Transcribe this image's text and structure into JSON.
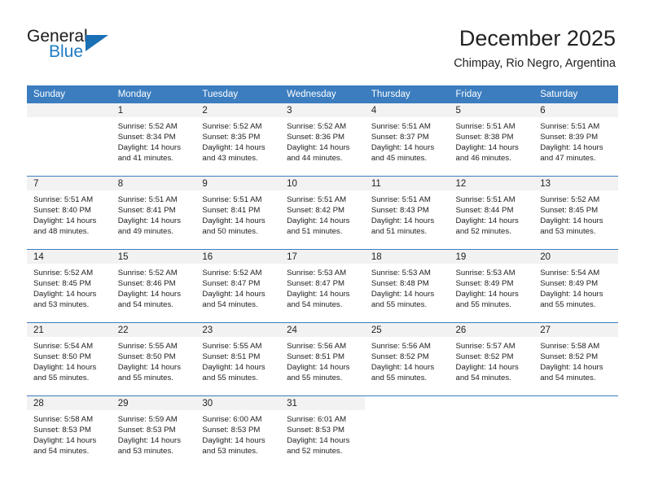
{
  "branding": {
    "logo_text_top": "General",
    "logo_text_bottom": "Blue",
    "logo_triangle_icon": "triangle-icon",
    "brand_blue": "#1d7cc4",
    "header_blue": "#3b7dbf"
  },
  "header": {
    "title": "December 2025",
    "location": "Chimpay, Rio Negro, Argentina"
  },
  "calendar": {
    "weekday_headers": [
      "Sunday",
      "Monday",
      "Tuesday",
      "Wednesday",
      "Thursday",
      "Friday",
      "Saturday"
    ],
    "weeks": [
      [
        {
          "blank": true
        },
        {
          "day": "1",
          "sunrise": "Sunrise: 5:52 AM",
          "sunset": "Sunset: 8:34 PM",
          "daylight_1": "Daylight: 14 hours",
          "daylight_2": "and 41 minutes."
        },
        {
          "day": "2",
          "sunrise": "Sunrise: 5:52 AM",
          "sunset": "Sunset: 8:35 PM",
          "daylight_1": "Daylight: 14 hours",
          "daylight_2": "and 43 minutes."
        },
        {
          "day": "3",
          "sunrise": "Sunrise: 5:52 AM",
          "sunset": "Sunset: 8:36 PM",
          "daylight_1": "Daylight: 14 hours",
          "daylight_2": "and 44 minutes."
        },
        {
          "day": "4",
          "sunrise": "Sunrise: 5:51 AM",
          "sunset": "Sunset: 8:37 PM",
          "daylight_1": "Daylight: 14 hours",
          "daylight_2": "and 45 minutes."
        },
        {
          "day": "5",
          "sunrise": "Sunrise: 5:51 AM",
          "sunset": "Sunset: 8:38 PM",
          "daylight_1": "Daylight: 14 hours",
          "daylight_2": "and 46 minutes."
        },
        {
          "day": "6",
          "sunrise": "Sunrise: 5:51 AM",
          "sunset": "Sunset: 8:39 PM",
          "daylight_1": "Daylight: 14 hours",
          "daylight_2": "and 47 minutes."
        }
      ],
      [
        {
          "day": "7",
          "sunrise": "Sunrise: 5:51 AM",
          "sunset": "Sunset: 8:40 PM",
          "daylight_1": "Daylight: 14 hours",
          "daylight_2": "and 48 minutes."
        },
        {
          "day": "8",
          "sunrise": "Sunrise: 5:51 AM",
          "sunset": "Sunset: 8:41 PM",
          "daylight_1": "Daylight: 14 hours",
          "daylight_2": "and 49 minutes."
        },
        {
          "day": "9",
          "sunrise": "Sunrise: 5:51 AM",
          "sunset": "Sunset: 8:41 PM",
          "daylight_1": "Daylight: 14 hours",
          "daylight_2": "and 50 minutes."
        },
        {
          "day": "10",
          "sunrise": "Sunrise: 5:51 AM",
          "sunset": "Sunset: 8:42 PM",
          "daylight_1": "Daylight: 14 hours",
          "daylight_2": "and 51 minutes."
        },
        {
          "day": "11",
          "sunrise": "Sunrise: 5:51 AM",
          "sunset": "Sunset: 8:43 PM",
          "daylight_1": "Daylight: 14 hours",
          "daylight_2": "and 51 minutes."
        },
        {
          "day": "12",
          "sunrise": "Sunrise: 5:51 AM",
          "sunset": "Sunset: 8:44 PM",
          "daylight_1": "Daylight: 14 hours",
          "daylight_2": "and 52 minutes."
        },
        {
          "day": "13",
          "sunrise": "Sunrise: 5:52 AM",
          "sunset": "Sunset: 8:45 PM",
          "daylight_1": "Daylight: 14 hours",
          "daylight_2": "and 53 minutes."
        }
      ],
      [
        {
          "day": "14",
          "sunrise": "Sunrise: 5:52 AM",
          "sunset": "Sunset: 8:45 PM",
          "daylight_1": "Daylight: 14 hours",
          "daylight_2": "and 53 minutes."
        },
        {
          "day": "15",
          "sunrise": "Sunrise: 5:52 AM",
          "sunset": "Sunset: 8:46 PM",
          "daylight_1": "Daylight: 14 hours",
          "daylight_2": "and 54 minutes."
        },
        {
          "day": "16",
          "sunrise": "Sunrise: 5:52 AM",
          "sunset": "Sunset: 8:47 PM",
          "daylight_1": "Daylight: 14 hours",
          "daylight_2": "and 54 minutes."
        },
        {
          "day": "17",
          "sunrise": "Sunrise: 5:53 AM",
          "sunset": "Sunset: 8:47 PM",
          "daylight_1": "Daylight: 14 hours",
          "daylight_2": "and 54 minutes."
        },
        {
          "day": "18",
          "sunrise": "Sunrise: 5:53 AM",
          "sunset": "Sunset: 8:48 PM",
          "daylight_1": "Daylight: 14 hours",
          "daylight_2": "and 55 minutes."
        },
        {
          "day": "19",
          "sunrise": "Sunrise: 5:53 AM",
          "sunset": "Sunset: 8:49 PM",
          "daylight_1": "Daylight: 14 hours",
          "daylight_2": "and 55 minutes."
        },
        {
          "day": "20",
          "sunrise": "Sunrise: 5:54 AM",
          "sunset": "Sunset: 8:49 PM",
          "daylight_1": "Daylight: 14 hours",
          "daylight_2": "and 55 minutes."
        }
      ],
      [
        {
          "day": "21",
          "sunrise": "Sunrise: 5:54 AM",
          "sunset": "Sunset: 8:50 PM",
          "daylight_1": "Daylight: 14 hours",
          "daylight_2": "and 55 minutes."
        },
        {
          "day": "22",
          "sunrise": "Sunrise: 5:55 AM",
          "sunset": "Sunset: 8:50 PM",
          "daylight_1": "Daylight: 14 hours",
          "daylight_2": "and 55 minutes."
        },
        {
          "day": "23",
          "sunrise": "Sunrise: 5:55 AM",
          "sunset": "Sunset: 8:51 PM",
          "daylight_1": "Daylight: 14 hours",
          "daylight_2": "and 55 minutes."
        },
        {
          "day": "24",
          "sunrise": "Sunrise: 5:56 AM",
          "sunset": "Sunset: 8:51 PM",
          "daylight_1": "Daylight: 14 hours",
          "daylight_2": "and 55 minutes."
        },
        {
          "day": "25",
          "sunrise": "Sunrise: 5:56 AM",
          "sunset": "Sunset: 8:52 PM",
          "daylight_1": "Daylight: 14 hours",
          "daylight_2": "and 55 minutes."
        },
        {
          "day": "26",
          "sunrise": "Sunrise: 5:57 AM",
          "sunset": "Sunset: 8:52 PM",
          "daylight_1": "Daylight: 14 hours",
          "daylight_2": "and 54 minutes."
        },
        {
          "day": "27",
          "sunrise": "Sunrise: 5:58 AM",
          "sunset": "Sunset: 8:52 PM",
          "daylight_1": "Daylight: 14 hours",
          "daylight_2": "and 54 minutes."
        }
      ],
      [
        {
          "day": "28",
          "sunrise": "Sunrise: 5:58 AM",
          "sunset": "Sunset: 8:53 PM",
          "daylight_1": "Daylight: 14 hours",
          "daylight_2": "and 54 minutes."
        },
        {
          "day": "29",
          "sunrise": "Sunrise: 5:59 AM",
          "sunset": "Sunset: 8:53 PM",
          "daylight_1": "Daylight: 14 hours",
          "daylight_2": "and 53 minutes."
        },
        {
          "day": "30",
          "sunrise": "Sunrise: 6:00 AM",
          "sunset": "Sunset: 8:53 PM",
          "daylight_1": "Daylight: 14 hours",
          "daylight_2": "and 53 minutes."
        },
        {
          "day": "31",
          "sunrise": "Sunrise: 6:01 AM",
          "sunset": "Sunset: 8:53 PM",
          "daylight_1": "Daylight: 14 hours",
          "daylight_2": "and 52 minutes."
        },
        {
          "blank": true
        },
        {
          "blank": true
        },
        {
          "blank": true
        }
      ]
    ]
  }
}
